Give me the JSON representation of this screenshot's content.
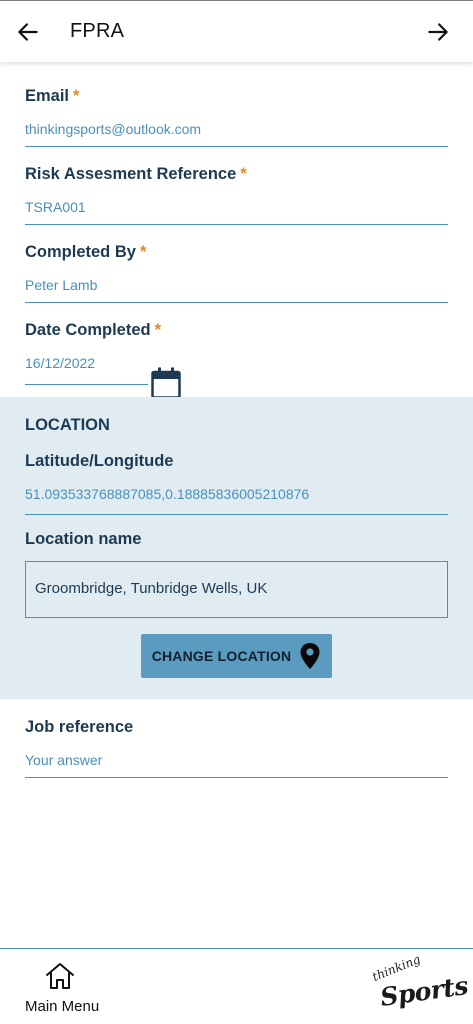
{
  "header": {
    "title": "FPRA"
  },
  "form": {
    "email": {
      "label": "Email",
      "required_mark": "*",
      "value": "thinkingsports@outlook.com"
    },
    "risk_ref": {
      "label": "Risk Assesment Reference",
      "required_mark": "*",
      "value": "TSRA001"
    },
    "completed_by": {
      "label": "Completed By",
      "required_mark": "*",
      "value": "Peter Lamb"
    },
    "date_completed": {
      "label": "Date Completed",
      "required_mark": "*",
      "value": "16/12/2022"
    }
  },
  "location": {
    "section_title": "LOCATION",
    "latlon_label": "Latitude/Longitude",
    "latlon_value": "51.093533768887085,0.18885836005210876",
    "name_label": "Location name",
    "name_value": "Groombridge, Tunbridge Wells, UK",
    "change_button": "CHANGE LOCATION"
  },
  "job": {
    "label": "Job reference",
    "placeholder": "Your answer"
  },
  "footer": {
    "menu_label": "Main Menu",
    "logo_top": "thinking",
    "logo_bottom": "Sports"
  },
  "colors": {
    "accent": "#4a90b8",
    "label": "#1d3a52",
    "required": "#e08a2c",
    "section_bg": "#e1ecf2",
    "button_bg": "#5b9bbf"
  },
  "icons": [
    "arrow-left-icon",
    "arrow-right-icon",
    "calendar-icon",
    "map-pin-icon",
    "home-icon"
  ]
}
